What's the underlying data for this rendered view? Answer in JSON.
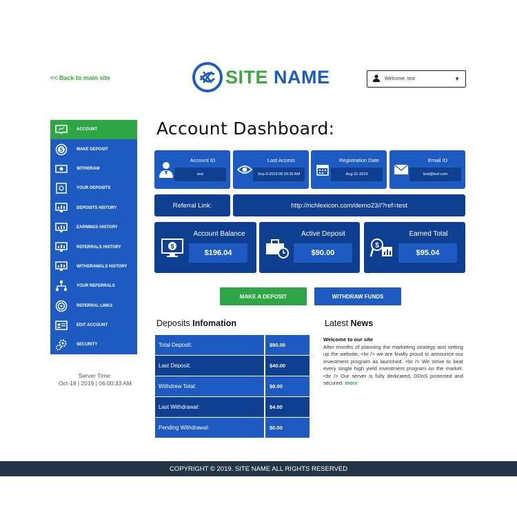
{
  "header": {
    "back_link": "<<  Back to main site",
    "logo_word1": "SITE",
    "logo_word2": "NAME",
    "welcome": "Welcome, test"
  },
  "sidebar": {
    "items": [
      {
        "label": "Account",
        "icon": "monitor-icon",
        "active": true
      },
      {
        "label": "Make Deposit",
        "icon": "dollar-icon"
      },
      {
        "label": "Withdraw",
        "icon": "cash-icon"
      },
      {
        "label": "Your Deposits",
        "icon": "safe-icon"
      },
      {
        "label": "Deposits History",
        "icon": "chart-monitor-icon"
      },
      {
        "label": "Earnings History",
        "icon": "chart-monitor-icon"
      },
      {
        "label": "Referrals History",
        "icon": "chart-monitor-icon"
      },
      {
        "label": "Withdrawals History",
        "icon": "chart-monitor-icon"
      },
      {
        "label": "Your Referrals",
        "icon": "network-icon"
      },
      {
        "label": "Referral Links",
        "icon": "target-icon"
      },
      {
        "label": "Edit Account",
        "icon": "id-card-icon"
      },
      {
        "label": "Security",
        "icon": "gears-icon"
      }
    ],
    "server_time_label": "Server Time:",
    "server_time_value": "Oct-18 | 2019 | 06:00:33 AM"
  },
  "main": {
    "title": "Account Dashboard:",
    "info_cards": [
      {
        "label": "Account ID",
        "value": "test",
        "icon": "user-icon"
      },
      {
        "label": "Last Access",
        "value": "Sep-3-2019 06:29:30 AM",
        "icon": "eye-icon"
      },
      {
        "label": "Registration Date",
        "value": "Aug-31-2019",
        "icon": "calendar-icon"
      },
      {
        "label": "Email ID",
        "value": "test@test.com",
        "icon": "envelope-icon"
      }
    ],
    "referral": {
      "label": "Referral Link:",
      "url": "http://richlexicon.com/demo23//?ref=test"
    },
    "stats": [
      {
        "label": "Account Balance",
        "value": "$196.04",
        "icon": "dollar-monitor-icon"
      },
      {
        "label": "Active Deposit",
        "value": "$90.00",
        "icon": "briefcase-clock-icon"
      },
      {
        "label": "Earned Total",
        "value": "$95.04",
        "icon": "money-chart-icon"
      }
    ],
    "buttons": {
      "deposit": "Make a Deposit",
      "withdraw": "Withdraw Funds"
    },
    "deposits_title_1": "Deposits ",
    "deposits_title_2": "Infomation",
    "deposits": [
      {
        "key": "Total Deposit:",
        "value": "$90.00"
      },
      {
        "key": "Last Deposit:",
        "value": "$40.00"
      },
      {
        "key": "Withdrew Total:",
        "value": "$9.00"
      },
      {
        "key": "Last Withdrawal:",
        "value": "$4.00"
      },
      {
        "key": "Pending Withdrawal:",
        "value": "$0.00"
      }
    ],
    "news_title_1": "Latest ",
    "news_title_2": "News",
    "news": {
      "heading": "Welcome to our site",
      "body": "After months of planning the marketing strategy and setting up the website, <br /> we are finally proud to announce our investment program as launched. <br /> We strive to beat every single high yield investment program on the market. <br /> Our server is fully dedicated, DDoS protected and secured.",
      "more": "more"
    }
  },
  "footer": {
    "copyright": "COPYRIGHT © 2019. SITE NAME ALL RIGHTS RESERVED"
  },
  "colors": {
    "blue": "#1d5bc2",
    "dark_blue": "#0f3f91",
    "green": "#2ea645",
    "footer": "#223649"
  }
}
